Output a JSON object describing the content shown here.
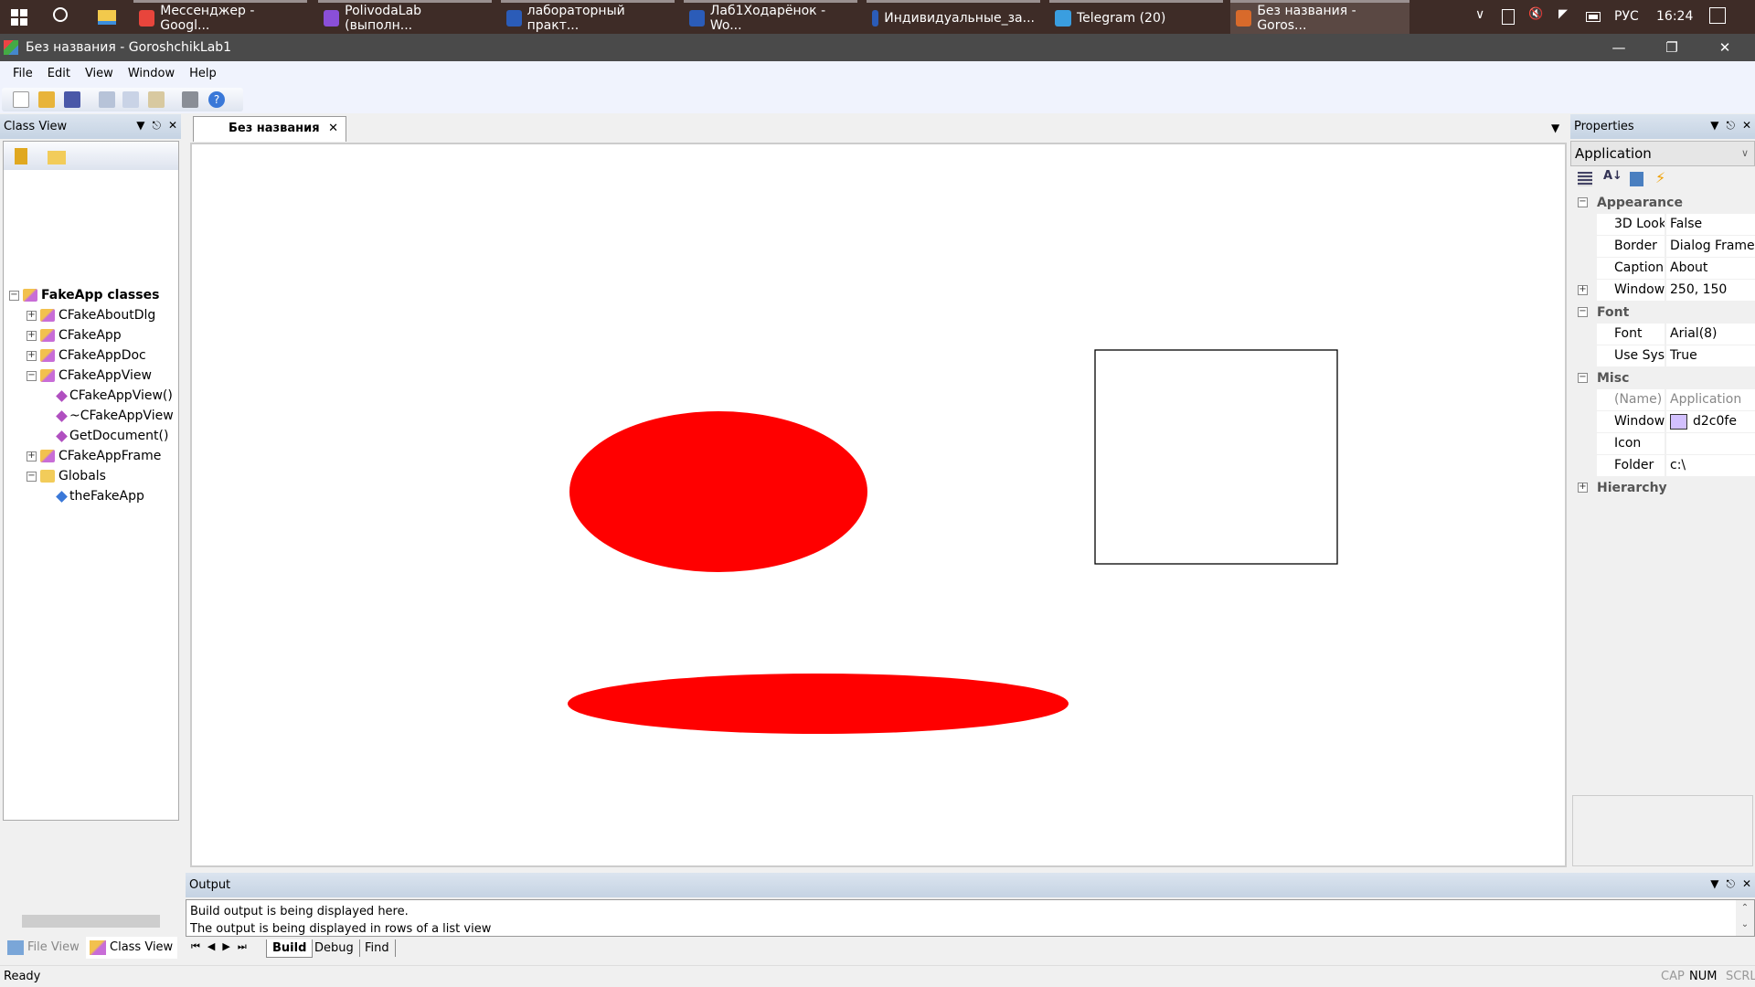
{
  "taskbar": {
    "items": [
      {
        "label": "Мессенджер - Googl...",
        "icon": "chrome-icon",
        "color": "#e8453c"
      },
      {
        "label": "PolivodaLab (выполн...",
        "icon": "visual-studio-icon",
        "color": "#8a4fd8"
      },
      {
        "label": "лабораторный практ...",
        "icon": "word-icon",
        "color": "#2b5cb8"
      },
      {
        "label": "Лаб1Ходарёнок - Wo...",
        "icon": "word-icon",
        "color": "#2b5cb8"
      },
      {
        "label": "Индивидуальные_за...",
        "icon": "word-icon",
        "color": "#2b5cb8"
      },
      {
        "label": "Telegram (20)",
        "icon": "telegram-icon",
        "color": "#3a9ee0"
      },
      {
        "label": "Без названия - Goros...",
        "icon": "mfc-app-icon",
        "color": "#d86a2b"
      }
    ],
    "lang": "РУС",
    "time": "16:24"
  },
  "window": {
    "title": "Без названия - GoroshchikLab1"
  },
  "menu": [
    "File",
    "Edit",
    "View",
    "Window",
    "Help"
  ],
  "class_view": {
    "title": "Class View",
    "tree": [
      {
        "label": "FakeApp classes",
        "level": 0,
        "bold": true,
        "expander": "−"
      },
      {
        "label": "CFakeAboutDlg",
        "level": 1,
        "expander": "+"
      },
      {
        "label": "CFakeApp",
        "level": 1,
        "expander": "+"
      },
      {
        "label": "CFakeAppDoc",
        "level": 1,
        "expander": "+"
      },
      {
        "label": "CFakeAppView",
        "level": 1,
        "expander": "−"
      },
      {
        "label": "CFakeAppView()",
        "level": 2
      },
      {
        "label": "~CFakeAppView",
        "level": 2
      },
      {
        "label": "GetDocument()",
        "level": 2
      },
      {
        "label": "CFakeAppFrame",
        "level": 1,
        "expander": "+"
      },
      {
        "label": "Globals",
        "level": 1,
        "expander": "−"
      },
      {
        "label": "theFakeApp",
        "level": 2
      }
    ],
    "bottom_tabs": [
      "File View",
      "Class View"
    ]
  },
  "document": {
    "tab": "Без названия",
    "shape_color": "#ff0000"
  },
  "properties": {
    "title": "Properties",
    "object": "Application",
    "groups": [
      {
        "name": "Appearance",
        "rows": [
          [
            "3D Look",
            "False"
          ],
          [
            "Border",
            "Dialog Frame"
          ],
          [
            "Caption",
            "About"
          ],
          [
            "Window ...",
            "250, 150"
          ]
        ]
      },
      {
        "name": "Font",
        "rows": [
          [
            "Font",
            "Arial(8)"
          ],
          [
            "Use Syst...",
            "True"
          ]
        ]
      },
      {
        "name": "Misc",
        "rows": [
          [
            "(Name)",
            "Application"
          ],
          [
            "Window ...",
            "d2c0fe"
          ],
          [
            "Icon",
            ""
          ],
          [
            "Folder",
            "c:\\"
          ]
        ]
      },
      {
        "name": "Hierarchy",
        "rows": []
      }
    ],
    "swatch_color": "#d2c0fe"
  },
  "output": {
    "title": "Output",
    "lines": [
      "Build output is being displayed here.",
      "The output is being displayed in rows of a list view"
    ],
    "tabs": [
      "Build",
      "Debug",
      "Find"
    ]
  },
  "status": {
    "text": "Ready",
    "indicators": [
      "CAP",
      "NUM",
      "SCRL"
    ]
  }
}
